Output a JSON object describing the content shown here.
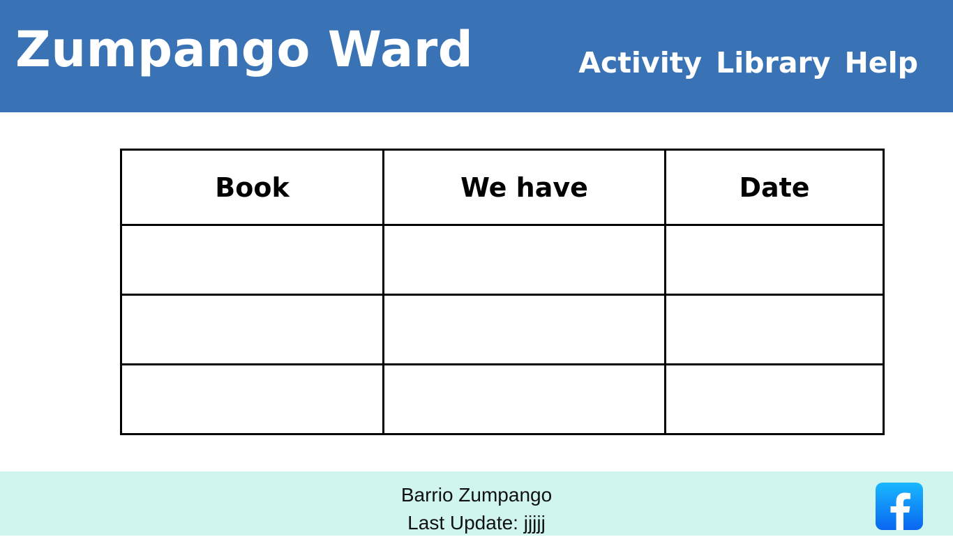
{
  "header": {
    "site_title": "Zumpango Ward",
    "nav": [
      {
        "label": "Activity"
      },
      {
        "label": "Library"
      },
      {
        "label": "Help"
      }
    ]
  },
  "table": {
    "headers": [
      "Book",
      "We have",
      "Date"
    ],
    "rows": [
      [
        "",
        "",
        ""
      ],
      [
        "",
        "",
        ""
      ],
      [
        "",
        "",
        ""
      ]
    ]
  },
  "footer": {
    "line1": "Barrio Zumpango",
    "line2": "Last Update: jjjjj",
    "social_icon": "facebook-icon"
  },
  "colors": {
    "header_bg": "#3a73b5",
    "footer_bg": "#cff5ee",
    "facebook_blue": "#0a66f0"
  }
}
